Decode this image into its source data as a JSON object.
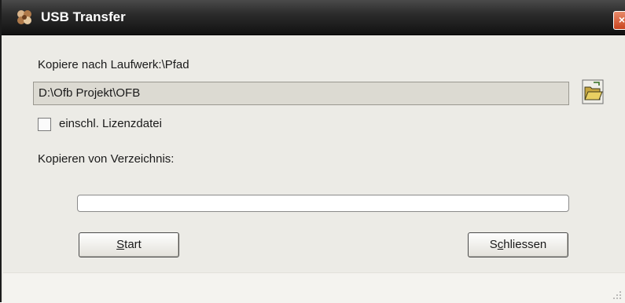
{
  "window": {
    "title": "USB Transfer",
    "icon": "usb-transfer-app-icon",
    "close_label": "×"
  },
  "form": {
    "target_label": "Kopiere nach Laufwerk:\\Pfad",
    "target_path": "D:\\Ofb Projekt\\OFB",
    "browse_icon": "folder-open-icon",
    "license_checkbox_label": "einschl. Lizenzdatei",
    "license_checked": false,
    "source_label": "Kopieren von Verzeichnis:",
    "progress": 0
  },
  "buttons": {
    "start_mnemonic": "S",
    "start_rest": "tart",
    "close_pre": "S",
    "close_mnemonic": "c",
    "close_rest": "hliessen"
  },
  "colors": {
    "titlebar": "#2c2c2c",
    "dialog_bg": "#ecebe6",
    "close_button": "#c9441f"
  }
}
